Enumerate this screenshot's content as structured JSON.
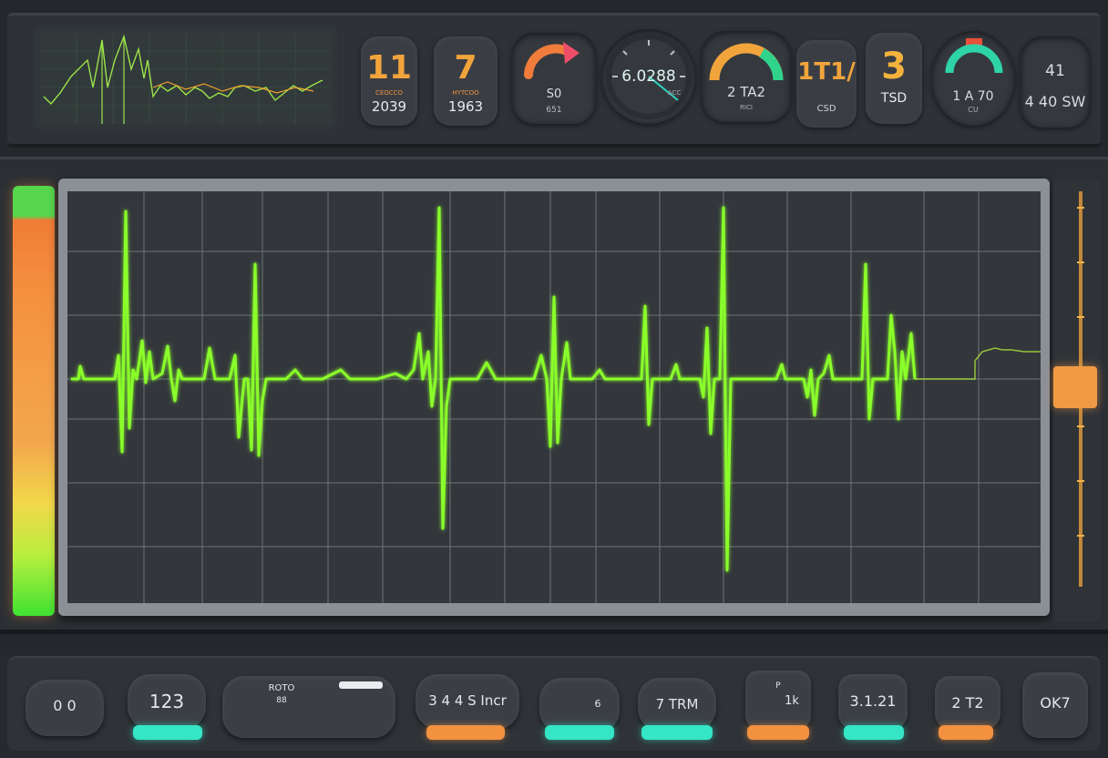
{
  "colors": {
    "waveform": "#8aff2a",
    "accent_orange": "#f19a45",
    "accent_teal": "#35e6c6",
    "background": "#24272c"
  },
  "top": {
    "readouts": [
      {
        "value": "11",
        "sub": "CEOCCO",
        "unit": "2039"
      },
      {
        "value": "7",
        "sub": "HYTCOO",
        "unit": "1963"
      }
    ],
    "gauge_a": {
      "label": "S0",
      "unit": "651"
    },
    "gauge_b": {
      "value": "6.0288",
      "unit": "ACC"
    },
    "gauge_c": {
      "value": "2 TA2",
      "unit": "RICI"
    },
    "text_d": {
      "value": "1T1/",
      "unit": "CSD"
    },
    "readout_e": {
      "value": "3",
      "unit": "TSD"
    },
    "gauge_f": {
      "value": "1 A 70",
      "unit": "CU"
    },
    "readout_g": {
      "value": "41",
      "unit": "4 40 SW"
    }
  },
  "bottom": {
    "buttons": [
      {
        "label": "0 0"
      },
      {
        "label": "123",
        "indicator": "teal"
      },
      {
        "label": "ROTO",
        "sub": "88"
      },
      {
        "label": "3 4 4 S Incr",
        "indicator": "orange"
      },
      {
        "label": "6",
        "indicator": "teal"
      },
      {
        "label": "7 TRM",
        "indicator": "teal"
      },
      {
        "label": "1k",
        "sub": "P",
        "indicator": "orange"
      },
      {
        "label": "3.1.21",
        "indicator": "teal"
      },
      {
        "label": "2 T2",
        "indicator": "orange"
      },
      {
        "label": "OK7"
      }
    ]
  }
}
